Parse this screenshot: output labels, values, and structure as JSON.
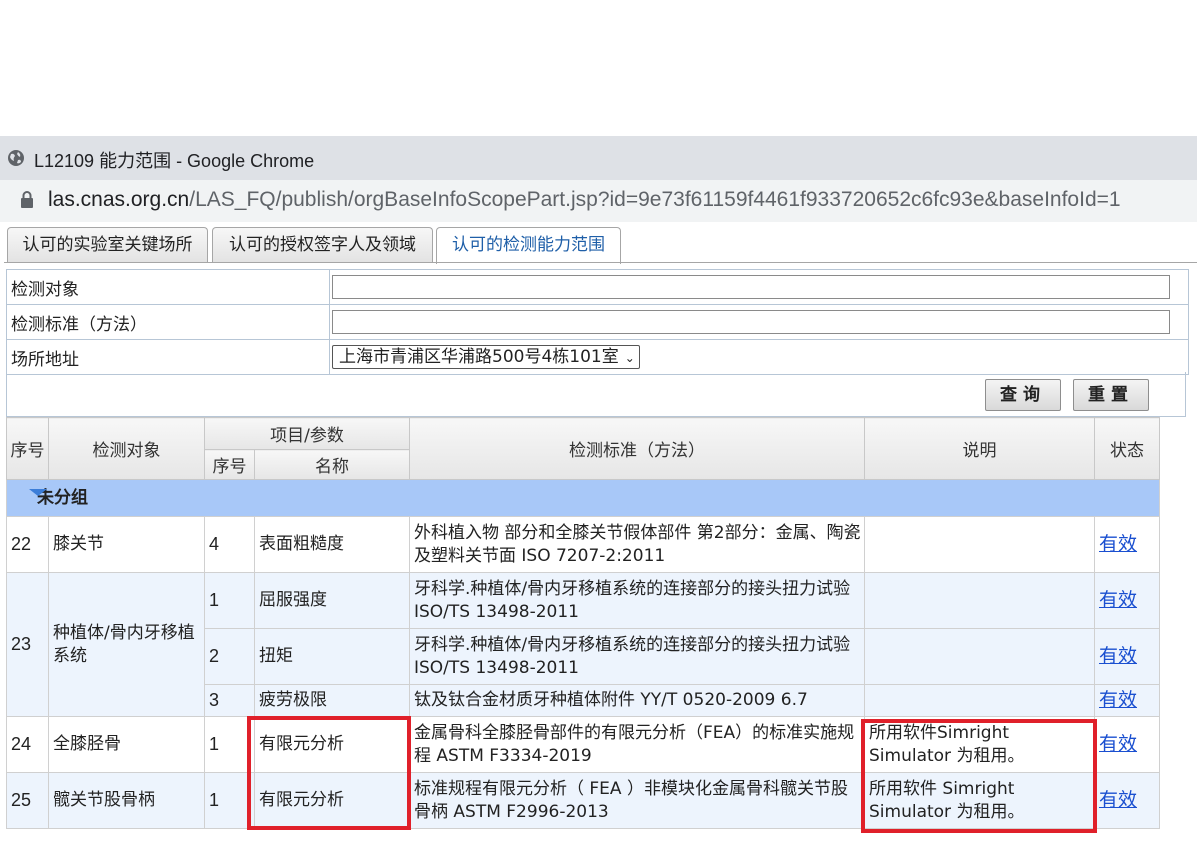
{
  "window": {
    "title": "L12109 能力范围 - Google Chrome",
    "icon": "globe-icon"
  },
  "address_bar": {
    "host": "las.cnas.org.cn",
    "path": "/LAS_FQ/publish/orgBaseInfoScopePart.jsp?id=9e73f61159f4461f933720652c6fc93e&baseInfoId=1",
    "icon": "lock-icon"
  },
  "tabs": [
    {
      "label": "认可的实验室关键场所",
      "active": false
    },
    {
      "label": "认可的授权签字人及领域",
      "active": false
    },
    {
      "label": "认可的检测能力范围",
      "active": true
    }
  ],
  "filters": {
    "object_label": "检测对象",
    "object_value": "",
    "standard_label": "检测标准（方法）",
    "standard_value": "",
    "site_label": "场所地址",
    "site_value": "上海市青浦区华浦路500号4栋101室"
  },
  "buttons": {
    "query": "查询",
    "reset": "重置"
  },
  "table": {
    "headers": {
      "seq": "序号",
      "object": "检测对象",
      "item_param": "项目/参数",
      "sub_seq": "序号",
      "name": "名称",
      "standard": "检测标准（方法）",
      "note": "说明",
      "status": "状态"
    },
    "group": "未分组",
    "rows": [
      {
        "seq": "22",
        "object": "膝关节",
        "sub": "4",
        "name": "表面粗糙度",
        "standard": "外科植入物 部分和全膝关节假体部件 第2部分：金属、陶瓷及塑料关节面 ISO 7207-2:2011",
        "note": "",
        "status": "有效"
      },
      {
        "seq": "23",
        "object": "种植体/骨内牙移植系统",
        "sub": "1",
        "name": "屈服强度",
        "standard": "牙科学.种植体/骨内牙移植系统的连接部分的接头扭力试验 ISO/TS 13498-2011",
        "note": "",
        "status": "有效"
      },
      {
        "sub": "2",
        "name": "扭矩",
        "standard": "牙科学.种植体/骨内牙移植系统的连接部分的接头扭力试验 ISO/TS 13498-2011",
        "note": "",
        "status": "有效"
      },
      {
        "sub": "3",
        "name": "疲劳极限",
        "standard": "钛及钛合金材质牙种植体附件 YY/T 0520-2009 6.7",
        "note": "",
        "status": "有效"
      },
      {
        "seq": "24",
        "object": "全膝胫骨",
        "sub": "1",
        "name": "有限元分析",
        "standard": "金属骨科全膝胫骨部件的有限元分析（FEA）的标准实施规程 ASTM F3334-2019",
        "note": "所用软件Simright Simulator 为租用。",
        "status": "有效"
      },
      {
        "seq": "25",
        "object": "髋关节股骨柄",
        "sub": "1",
        "name": "有限元分析",
        "standard": "标准规程有限元分析（ FEA ）非模块化金属骨科髋关节股骨柄 ASTM F2996-2013",
        "note": "所用软件 Simright Simulator 为租用。",
        "status": "有效"
      }
    ]
  },
  "colors": {
    "highlight_box": "#e0202a",
    "group_row": "#a8c8f8",
    "link": "#1a4fd0"
  }
}
